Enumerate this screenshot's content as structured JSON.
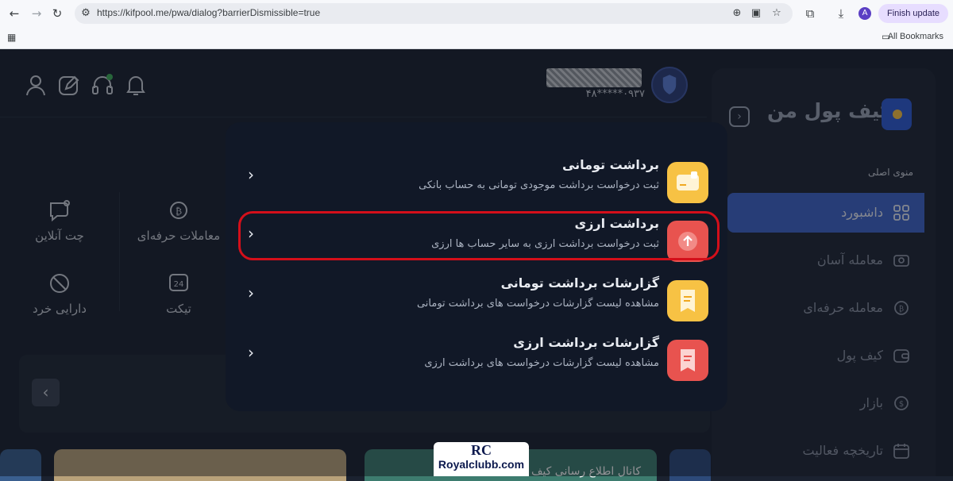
{
  "browser": {
    "url": "https://kifpool.me/pwa/dialog?barrierDismissible=true",
    "finish_update": "Finish update",
    "profile_initial": "A",
    "bookmarks_label": "All Bookmarks"
  },
  "header": {
    "user_phone": "۰۹۳۷*****۴۸"
  },
  "quick_actions": [
    {
      "label": "چت آنلاین",
      "icon": "chat-icon"
    },
    {
      "label": "معاملات حرفه‌ای",
      "icon": "bitcoin-exchange-icon"
    },
    {
      "label": "دارایی خرد",
      "icon": "no-money-icon"
    },
    {
      "label": "تیکت",
      "icon": "ticket-24-icon"
    }
  ],
  "banners": {
    "right_text": "کانال اطلاع رسانی کیف"
  },
  "sidebar": {
    "logo_text": "کیف پول من",
    "menu_title": "منوی اصلی",
    "items": [
      {
        "label": "داشبورد",
        "icon": "grid-icon",
        "active": true
      },
      {
        "label": "معامله آسان",
        "icon": "easy-trade-icon",
        "active": false
      },
      {
        "label": "معامله حرفه‌ای",
        "icon": "pro-trade-icon",
        "active": false
      },
      {
        "label": "کیف پول",
        "icon": "wallet-icon",
        "active": false
      },
      {
        "label": "بازار",
        "icon": "market-icon",
        "active": false
      },
      {
        "label": "تاریخچه فعالیت",
        "icon": "calendar-icon",
        "active": false
      }
    ]
  },
  "modal": {
    "options": [
      {
        "title": "برداشت تومانی",
        "subtitle": "ثبت درخواست برداشت موجودی تومانی به حساب بانکی",
        "icon": "toman-withdraw-icon",
        "color": "#f7c244"
      },
      {
        "title": "برداشت ارزی",
        "subtitle": "ثبت درخواست برداشت ارزی به سایر حساب ها ارزی",
        "icon": "crypto-withdraw-icon",
        "color": "#e8534f"
      },
      {
        "title": "گزارشات برداشت تومانی",
        "subtitle": "مشاهده لیست گزارشات درخواست های برداشت تومانی",
        "icon": "toman-report-icon",
        "color": "#f7c244"
      },
      {
        "title": "گزارشات برداشت ارزی",
        "subtitle": "مشاهده لیست گزارشات درخواست های برداشت ارزی",
        "icon": "crypto-report-icon",
        "color": "#e8534f"
      }
    ]
  },
  "watermark": {
    "logo": "RC",
    "site": "Royalclubb.com"
  },
  "colors": {
    "accent": "#3f64c8",
    "highlight_ring": "#d40f1a",
    "modal_bg": "#111827",
    "app_bg": "#1b2230"
  }
}
